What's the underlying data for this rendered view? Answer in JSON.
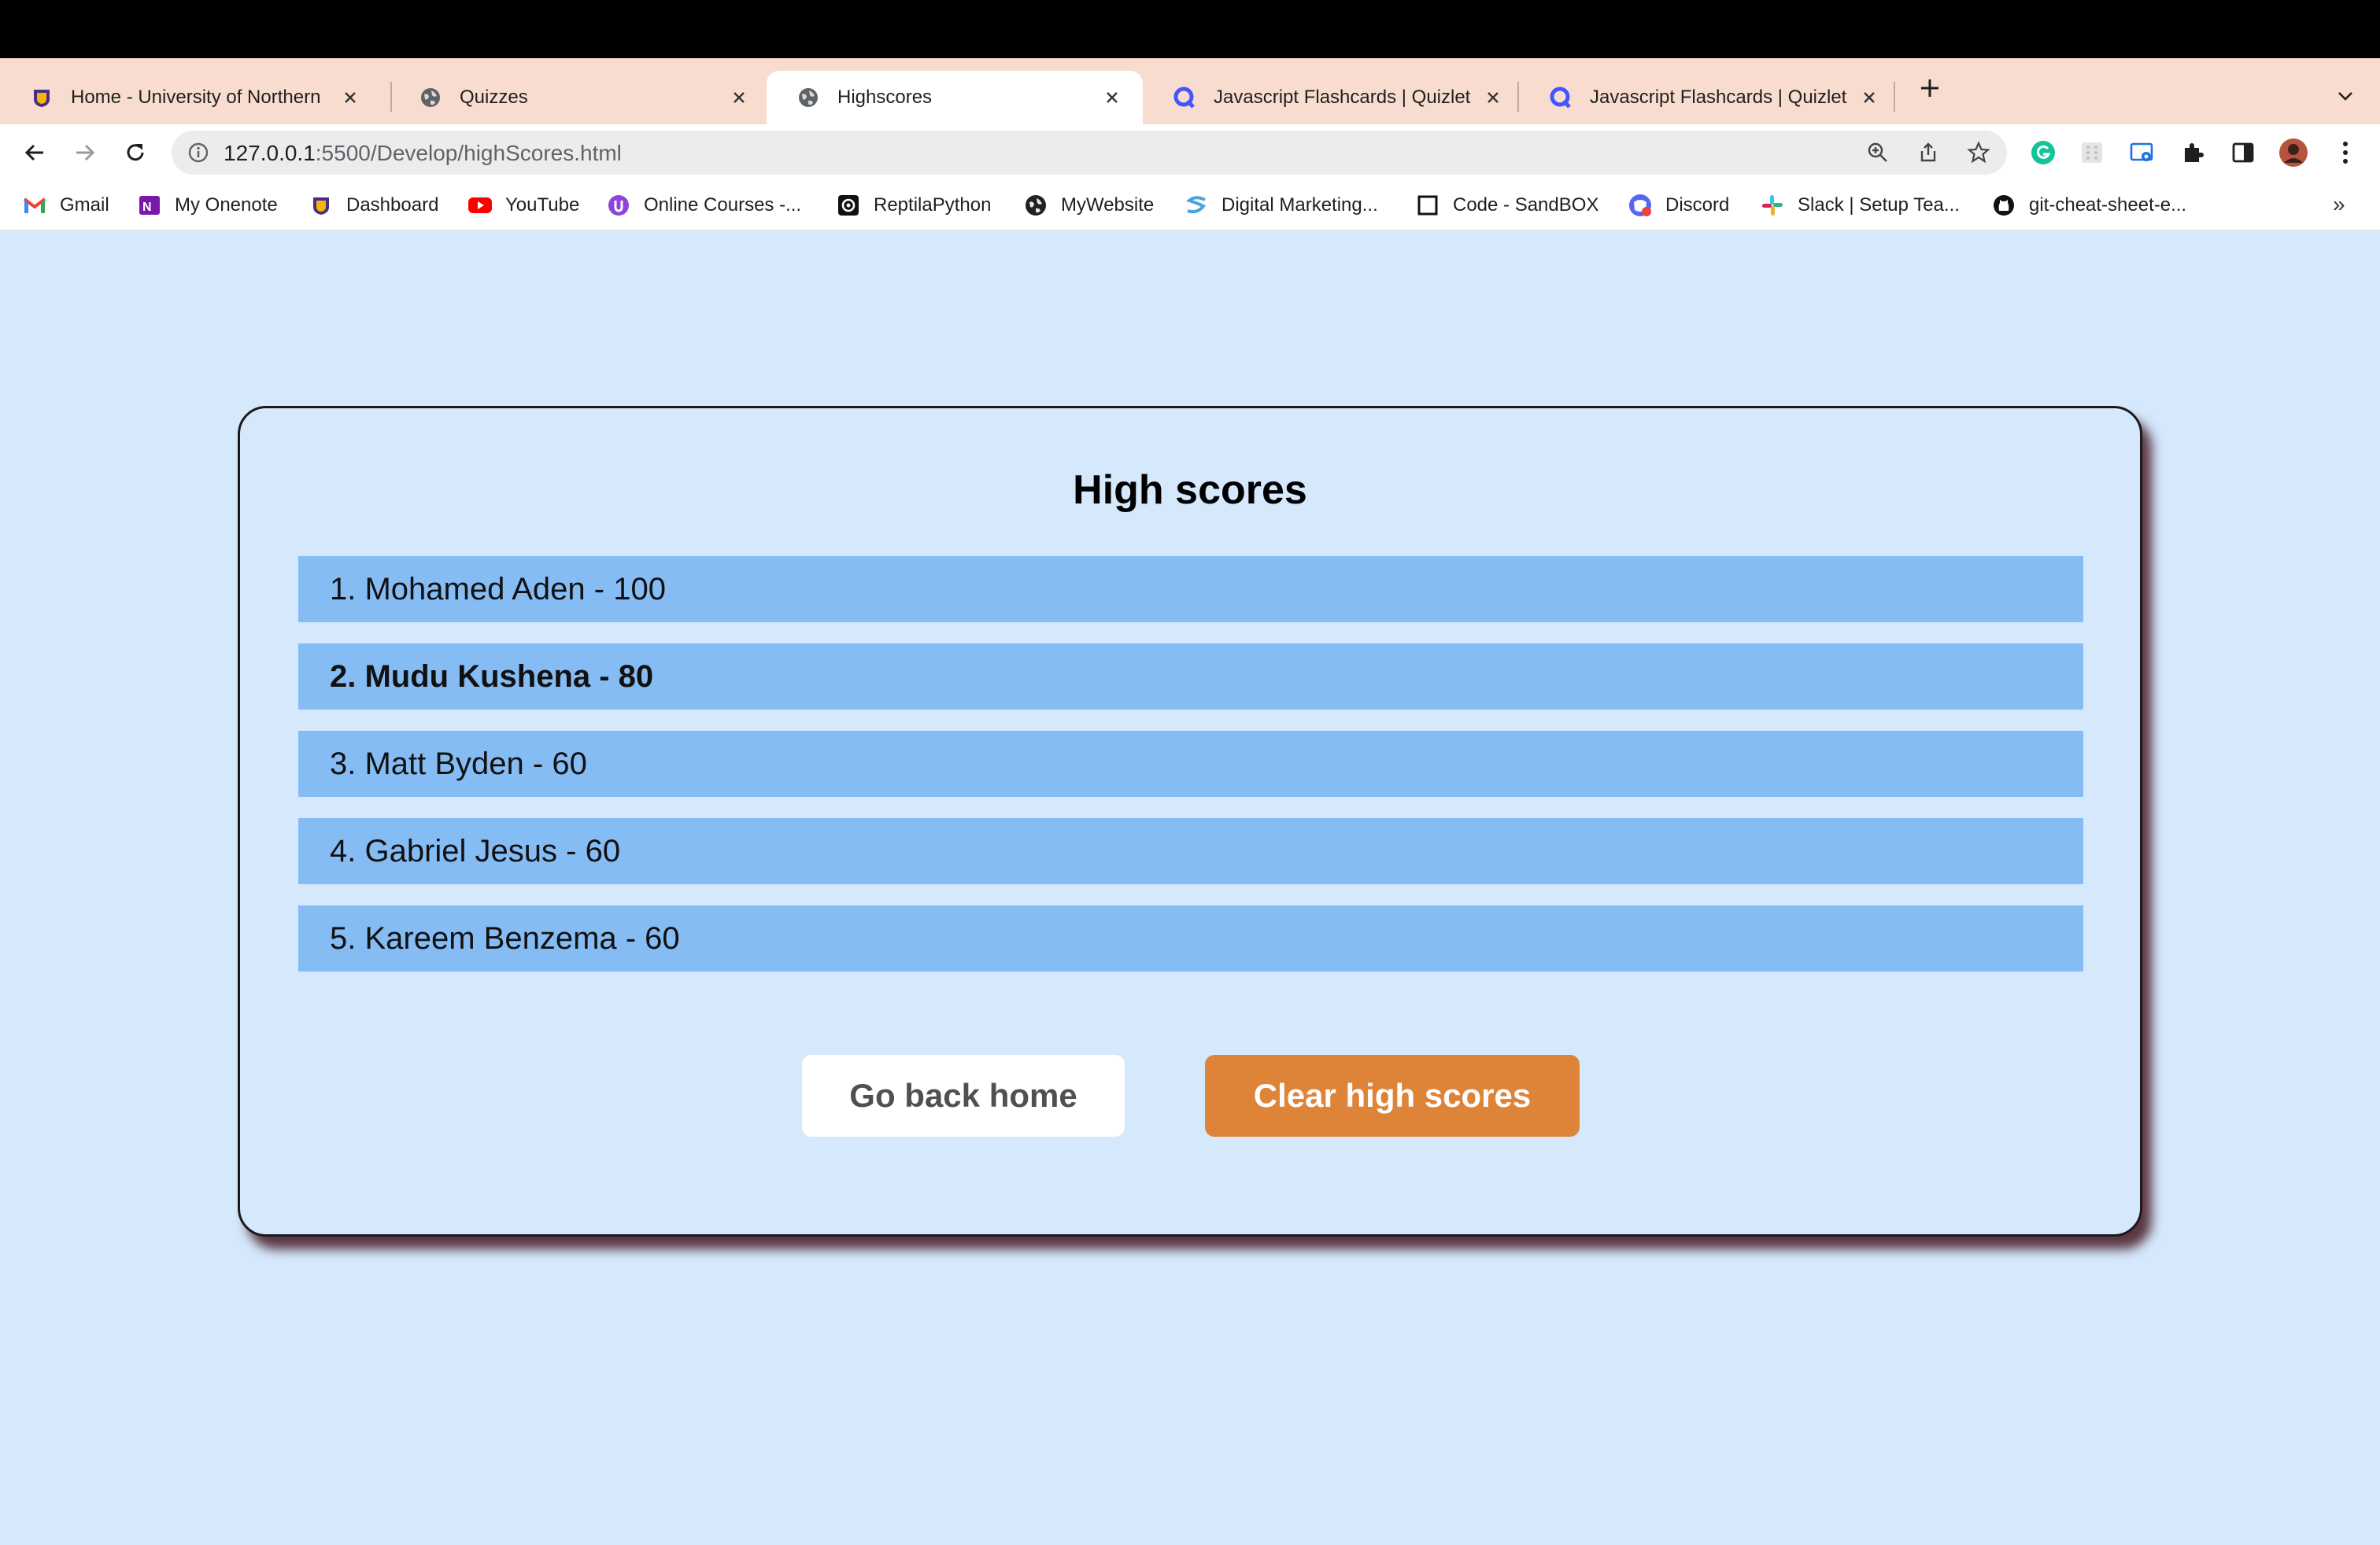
{
  "browser": {
    "tabs": [
      {
        "title": "Home - University of Northern",
        "icon": "university-logo-icon"
      },
      {
        "title": "Quizzes",
        "icon": "globe-icon"
      },
      {
        "title": "Highscores",
        "icon": "globe-icon",
        "active": true
      },
      {
        "title": "Javascript Flashcards | Quizlet",
        "icon": "quizlet-icon"
      },
      {
        "title": "Javascript Flashcards | Quizlet",
        "icon": "quizlet-icon"
      }
    ],
    "address": {
      "host": "127.0.0.1",
      "path": ":5500/Develop/highScores.html"
    },
    "bookmarks": [
      {
        "label": "Gmail",
        "icon": "gmail-icon"
      },
      {
        "label": "My Onenote",
        "icon": "onenote-icon"
      },
      {
        "label": "Dashboard",
        "icon": "university-logo-icon"
      },
      {
        "label": "YouTube",
        "icon": "youtube-icon"
      },
      {
        "label": "Online Courses -...",
        "icon": "courses-icon"
      },
      {
        "label": "ReptilaPython",
        "icon": "python-icon"
      },
      {
        "label": "MyWebsite",
        "icon": "globe-icon"
      },
      {
        "label": "Digital Marketing...",
        "icon": "marketing-icon"
      },
      {
        "label": "Code - SandBOX",
        "icon": "sandbox-icon"
      },
      {
        "label": "Discord",
        "icon": "discord-icon"
      },
      {
        "label": "Slack | Setup Tea...",
        "icon": "slack-icon"
      },
      {
        "label": "git-cheat-sheet-e...",
        "icon": "github-icon"
      }
    ],
    "bookmarks_overflow": "»",
    "colors": {
      "tabstrip": "#f8dccf",
      "page_background": "#d5e8fc"
    }
  },
  "page": {
    "title": "High scores",
    "scores": [
      "1. Mohamed Aden - 100",
      "2. Mudu Kushena - 80",
      "3. Matt Byden - 60",
      "4. Gabriel Jesus - 60",
      "5. Kareem Benzema - 60"
    ],
    "buttons": {
      "home": "Go back home",
      "clear": "Clear high scores"
    },
    "colors": {
      "score_row": "#86bcf4",
      "clear_button": "#de8439"
    }
  }
}
